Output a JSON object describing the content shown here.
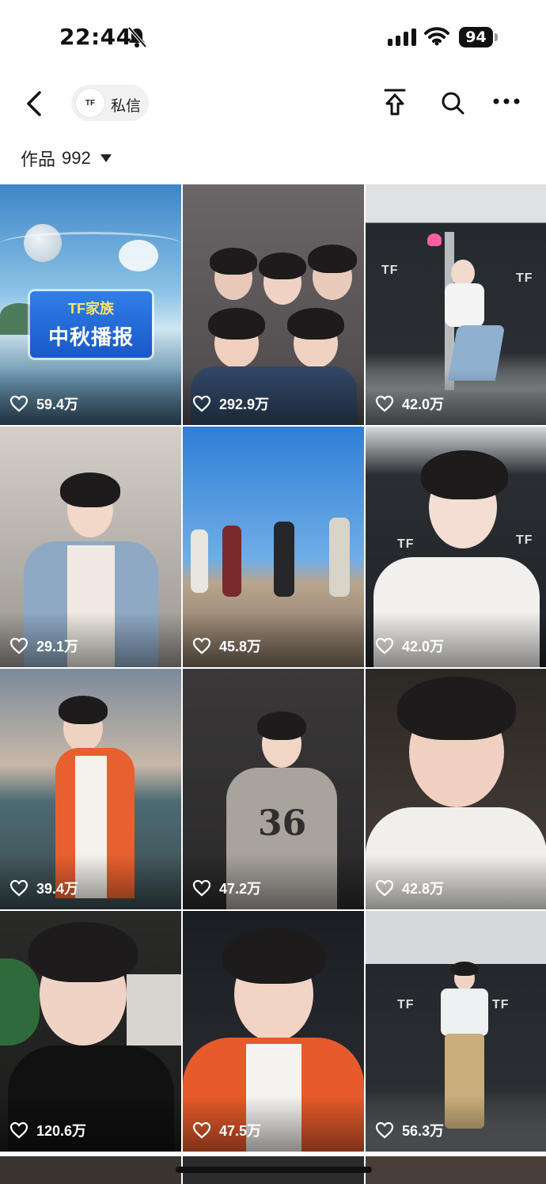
{
  "status_bar": {
    "time": "22:44",
    "battery": "94",
    "icons": [
      "bell-slash-icon",
      "cellular-signal-icon",
      "wifi-icon",
      "battery-icon"
    ]
  },
  "header": {
    "back_icon": "chevron-left-icon",
    "dm_avatar_text": "TF",
    "dm_label": "私信",
    "share_icon": "share-upload-icon",
    "search_icon": "search-icon",
    "more_icon": "more-dots-icon"
  },
  "works_tab": {
    "label": "作品",
    "count": "992",
    "caret_icon": "caret-down-icon"
  },
  "banner": {
    "line1": "TF家族",
    "line2": "中秋播报"
  },
  "videos": [
    {
      "likes": "59.4万"
    },
    {
      "likes": "292.9万"
    },
    {
      "likes": "42.0万"
    },
    {
      "likes": "29.1万"
    },
    {
      "likes": "45.8万"
    },
    {
      "likes": "42.0万"
    },
    {
      "likes": "39.4万"
    },
    {
      "likes": "47.2万"
    },
    {
      "likes": "42.8万"
    },
    {
      "likes": "120.6万"
    },
    {
      "likes": "47.5万"
    },
    {
      "likes": "56.3万"
    }
  ],
  "like_icon": "heart-outline-icon",
  "colors": {
    "accent_chip_bg": "#f1f1f3",
    "text": "#111111",
    "banner_blue": "#1a58c7",
    "banner_yellow": "#ffe36b"
  }
}
